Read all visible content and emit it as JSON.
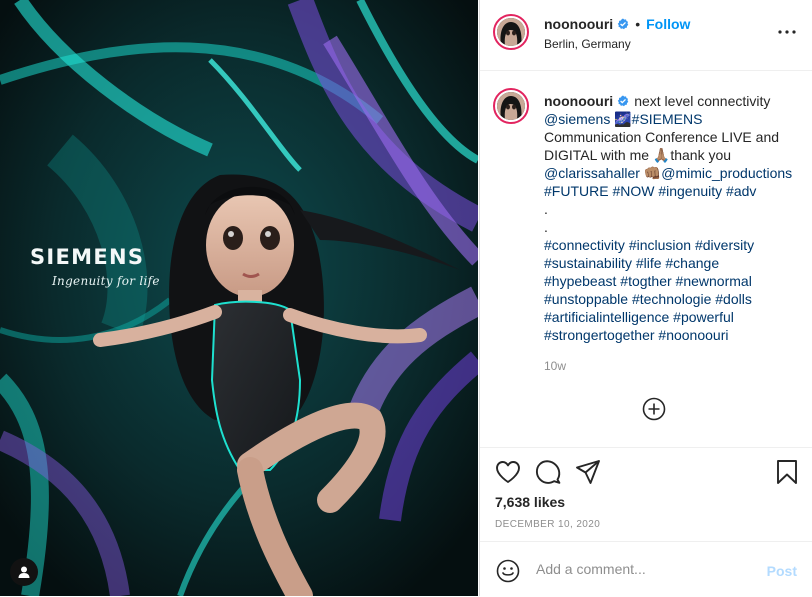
{
  "media": {
    "brand_name": "SIEMENS",
    "brand_tagline": "Ingenuity for life",
    "tag_icon": "user-tag-icon"
  },
  "header": {
    "username": "noonoouri",
    "separator": "•",
    "follow_label": "Follow",
    "location": "Berlin, Germany",
    "more_icon": "more-options-icon"
  },
  "caption": {
    "username": "noonoouri",
    "line1": "next level connectivity",
    "line2a": "@siemens",
    "line2b": " 🌌#SIEMENS",
    "line3": "Communication Conference LIVE and",
    "line4": "DIGITAL with me 🙏🏽thank you",
    "line5a": "@clarissahaller",
    "line5b": " 👊🏽",
    "line5c": "@mimic_productions",
    "line6": "#FUTURE #NOW #ingenuity #adv",
    "line7": ".",
    "line8": ".",
    "line9": "#connectivity #inclusion #diversity",
    "line10": "#sustainability #life #change",
    "line11": "#hypebeast #togther #newnormal",
    "line12": "#unstoppable #technologie #dolls",
    "line13": "#artificialintelligence #powerful",
    "line14": "#strongertogether #noonoouri",
    "time": "10w"
  },
  "actions": {
    "like_icon": "heart-icon",
    "comment_icon": "comment-icon",
    "share_icon": "share-icon",
    "save_icon": "bookmark-icon",
    "likes": "7,638 likes",
    "date": "DECEMBER 10, 2020"
  },
  "comment": {
    "placeholder": "Add a comment...",
    "post_label": "Post"
  },
  "colors": {
    "accent": "#0095f6",
    "link": "#00376b",
    "story_ring": "#e2245f",
    "muted": "#8e8e8e"
  }
}
